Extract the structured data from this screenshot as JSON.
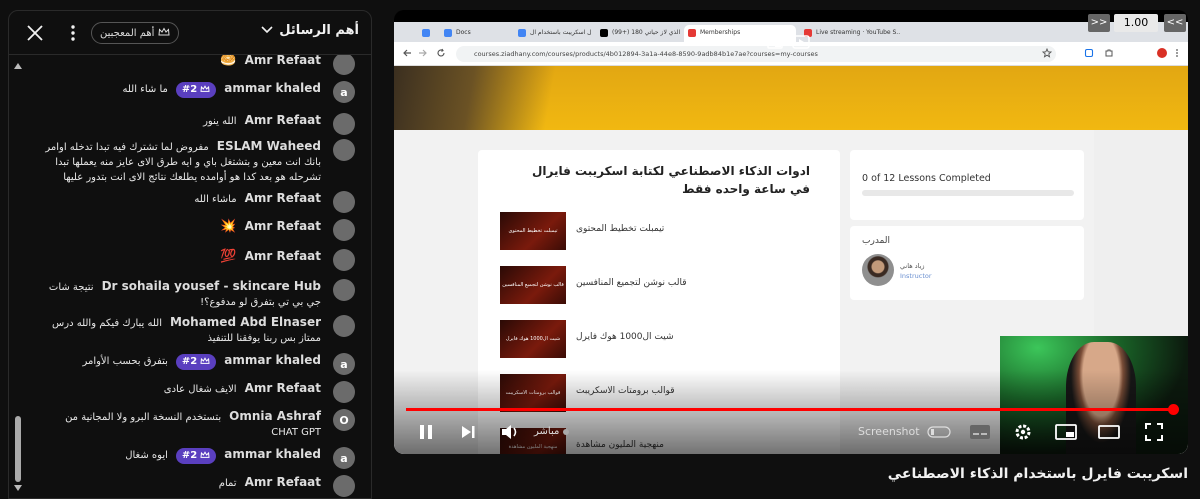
{
  "chat": {
    "title": "أهم الرسائل",
    "top_fans_label": "أهم المعجبين",
    "messages": [
      {
        "author": "Amr Refaat",
        "text": "",
        "badge": "",
        "avatar": "person",
        "emoji": "🥯"
      },
      {
        "author": "ammar khaled",
        "text": "ما شاء الله",
        "badge": "#2",
        "avatar": "a"
      },
      {
        "author": "Amr Refaat",
        "text": "الله ينور",
        "badge": "",
        "avatar": "person"
      },
      {
        "author": "ESLAM Waheed",
        "text": "مفروض لما تشترك فيه تبدا تدخله اوامر بانك انت معين و بتشتغل باي و ايه طرق الاى عايز منه يعملها تبدا تشرحله هو بعد كدا هو أوامده يطلعك نتائج الاى انت بتدور عليها",
        "badge": "",
        "avatar": "photo1"
      },
      {
        "author": "Amr Refaat",
        "text": "ماشاء الله",
        "badge": "",
        "avatar": "person"
      },
      {
        "author": "Amr Refaat",
        "text": "",
        "badge": "",
        "avatar": "person",
        "emoji": "💥"
      },
      {
        "author": "Amr Refaat",
        "text": "",
        "badge": "",
        "avatar": "person",
        "emoji": "💯"
      },
      {
        "author": "Dr sohaila yousef - skincare Hub",
        "text": "نتيجة شات جي بي تي بتفرق لو مدفوع؟!",
        "badge": "",
        "avatar": "photo2"
      },
      {
        "author": "Mohamed Abd Elnaser",
        "text": "الله يبارك فيكم والله درس ممتاز بس ربنا يوفقنا للتنفيذ",
        "badge": "",
        "avatar": "photo3"
      },
      {
        "author": "ammar khaled",
        "text": "بتفرق بحسب الأوامر",
        "badge": "#2",
        "avatar": "a"
      },
      {
        "author": "Amr Refaat",
        "text": "الايف شغال عادى",
        "badge": "",
        "avatar": "person"
      },
      {
        "author": "Omnia Ashraf",
        "text": "بتستخدم النسخة البرو ولا المجانية من CHAT GPT",
        "badge": "",
        "avatar": "O"
      },
      {
        "author": "ammar khaled",
        "text": "ايوه شغال",
        "badge": "#2",
        "avatar": "a"
      },
      {
        "author": "Amr Refaat",
        "text": "تمام",
        "badge": "",
        "avatar": "person"
      }
    ]
  },
  "browser": {
    "tabs": [
      {
        "label": "",
        "color": "#4285f4"
      },
      {
        "label": "Docs",
        "color": "#4285f4"
      },
      {
        "label": "فايرال اسكريبت باستخدام ال...",
        "color": "#4285f4"
      },
      {
        "label": "(99+) اكبر الذي لاز حياتي 180 ...",
        "color": "#000000"
      },
      {
        "label": "Memberships",
        "color": "#e53935"
      },
      {
        "label": "Live streaming · YouTube S...",
        "color": "#e53935"
      }
    ],
    "url": "courses.ziadhany.com/courses/products/4b012894-3a1a-44e8-8590-9adb84b1e7ae?courses=my-courses"
  },
  "course": {
    "title": "ادوات الذكاء الاصطناعي لكتابة اسكريبت فايرال في ساعة واحده فقط",
    "lessons": [
      {
        "title": "تيمبلت تخطيط المحتوى",
        "thumb": "تيمبلت تخطيط المحتوى"
      },
      {
        "title": "قالب نوشن لتجميع المنافسين",
        "thumb": "قالب نوشن لتجميع المنافسين"
      },
      {
        "title": "شيت ال1000 هوك فايرل",
        "thumb": "شيت ال1000 هوك فايرل"
      },
      {
        "title": "قوالب برومتات الاسكريبت",
        "thumb": "قوالب برومتات الاسكريبت"
      },
      {
        "title": "منهجية المليون مشاهدة",
        "thumb": "منهجية المليون مشاهدة"
      }
    ],
    "progress_text": "0 of 12 Lessons Completed",
    "progress_fraction": 0,
    "instructor_heading": "المدرب",
    "instructor_name": "زياد هاني",
    "instructor_role": "Instructor"
  },
  "player": {
    "speed": "1.00",
    "speed_down": "<<",
    "speed_up": ">>",
    "live_label": "مباشر",
    "screenshot_label": "Screenshot",
    "progress_fraction": 0.998,
    "video_title": "اسكريبت فايرل باستخدام الذكاء الاصطناعي"
  },
  "colors": {
    "badge": "#5a3fbf",
    "seek": "#ff0000",
    "accent_yellow": "#f1b811"
  }
}
